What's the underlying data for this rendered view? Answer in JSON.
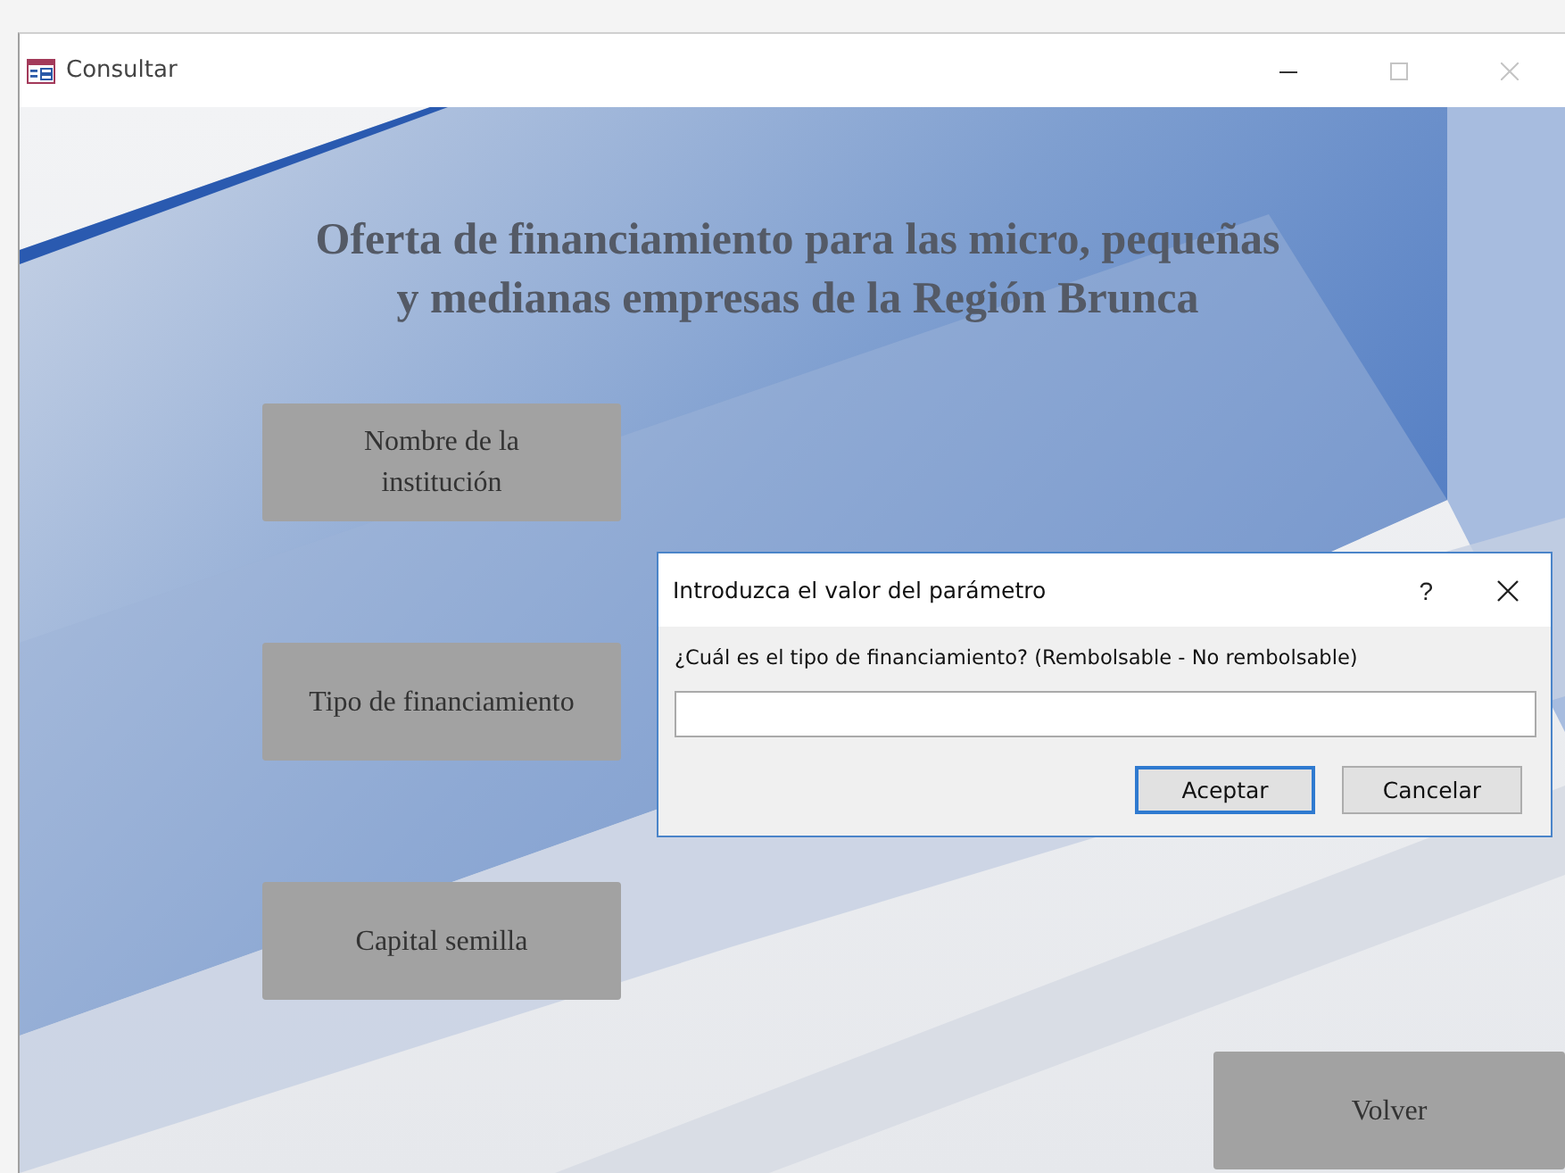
{
  "window": {
    "title": "Consultar",
    "controls": [
      {
        "kind": "minimize",
        "disabled": false
      },
      {
        "kind": "maximize",
        "disabled": true
      },
      {
        "kind": "close",
        "disabled": true
      }
    ]
  },
  "form": {
    "heading": "Oferta de financiamiento para las micro, pequeñas\ny medianas empresas de la Región Brunca",
    "buttons": [
      {
        "label": "Nombre de la\ninstitución"
      },
      {
        "label": "Tipo de financiamiento"
      },
      {
        "label": "Capital semilla"
      }
    ],
    "back_button": "Volver"
  },
  "dialog": {
    "title": "Introduzca el valor del parámetro",
    "help": "?",
    "prompt": "¿Cuál es el tipo de financiamiento? (Rembolsable - No rembolsable)",
    "buttons": [
      {
        "label": "Aceptar",
        "default": true
      },
      {
        "label": "Cancelar",
        "default": false
      }
    ]
  }
}
